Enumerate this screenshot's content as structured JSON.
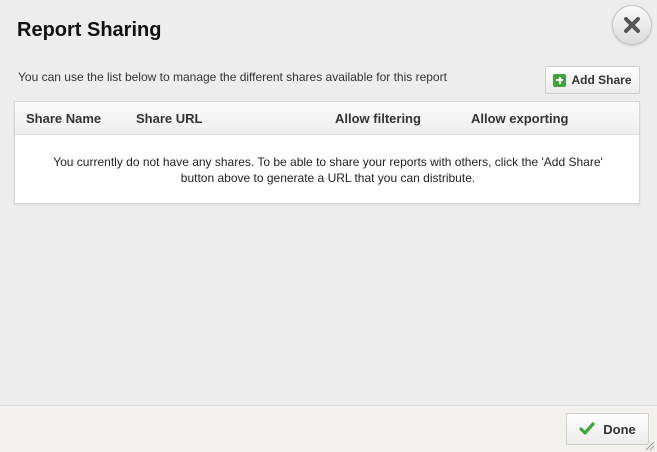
{
  "dialog": {
    "title": "Report Sharing",
    "description": "You can use the list below to manage the different shares available for this report"
  },
  "toolbar": {
    "add_share_label": "Add Share",
    "add_share_icon": "plus-icon"
  },
  "table": {
    "columns": [
      "Share Name",
      "Share URL",
      "Allow filtering",
      "Allow exporting"
    ],
    "empty_message_line1": "You currently do not have any shares. To be able to share your reports with others, click the 'Add Share'",
    "empty_message_line2": "button above to generate a URL that you can distribute."
  },
  "footer": {
    "done_label": "Done",
    "done_icon": "checkmark-icon"
  },
  "colors": {
    "accent_green": "#3fa63a",
    "background": "#ededed",
    "panel": "#ffffff"
  }
}
